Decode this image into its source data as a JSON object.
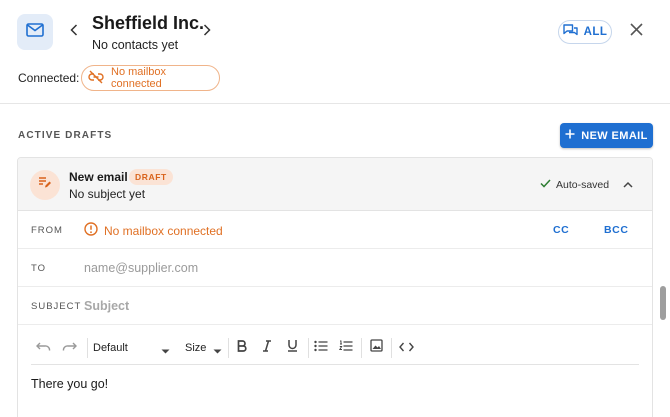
{
  "header": {
    "company_name": "Sheffield Inc.",
    "company_subtitle": "No contacts yet",
    "all_label": "ALL",
    "connected_label": "Connected:",
    "mailbox_chip_label": "No mailbox connected"
  },
  "drafts": {
    "section_title": "ACTIVE DRAFTS",
    "new_email_label": "NEW EMAIL",
    "draft": {
      "title": "New email",
      "badge": "DRAFT",
      "subject_preview": "No subject yet",
      "autosave_label": "Auto-saved"
    },
    "from": {
      "label": "FROM",
      "warning": "No mailbox connected",
      "cc_label": "CC",
      "bcc_label": "BCC"
    },
    "to": {
      "label": "TO",
      "placeholder": "name@supplier.com",
      "value": ""
    },
    "subject": {
      "label": "SUBJECT",
      "placeholder": "Subject",
      "value": ""
    },
    "toolbar": {
      "style_value": "Default",
      "size_value": "Size"
    },
    "body_text": "There you go!"
  },
  "colors": {
    "accent": "#1f6fd1",
    "warning": "#e07024",
    "draft_badge_bg": "#fbe3d5"
  }
}
